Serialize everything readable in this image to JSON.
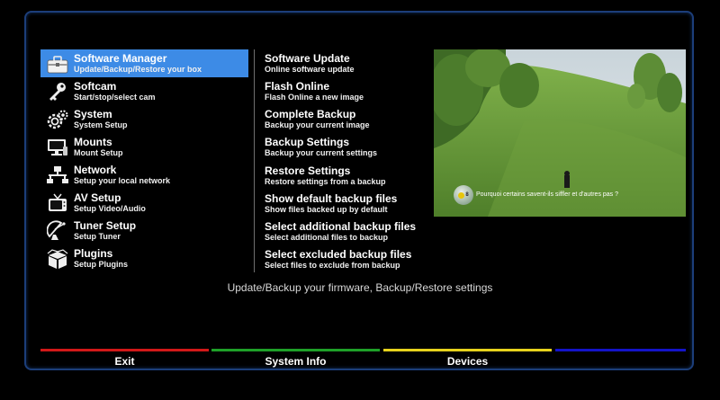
{
  "menu": {
    "items": [
      {
        "title": "Software Manager",
        "sub": "Update/Backup/Restore your box",
        "icon": "toolbox-icon"
      },
      {
        "title": "Softcam",
        "sub": "Start/stop/select cam",
        "icon": "key-icon"
      },
      {
        "title": "System",
        "sub": "System Setup",
        "icon": "gears-icon"
      },
      {
        "title": "Mounts",
        "sub": "Mount Setup",
        "icon": "monitor-icon"
      },
      {
        "title": "Network",
        "sub": "Setup your local network",
        "icon": "network-icon"
      },
      {
        "title": "AV Setup",
        "sub": "Setup Video/Audio",
        "icon": "tv-icon"
      },
      {
        "title": "Tuner Setup",
        "sub": "Setup Tuner",
        "icon": "satellite-dish-icon"
      },
      {
        "title": "Plugins",
        "sub": "Setup Plugins",
        "icon": "puzzle-box-icon"
      }
    ],
    "selected_index": 0
  },
  "sublist": {
    "items": [
      {
        "title": "Software Update",
        "sub": "Online software update"
      },
      {
        "title": "Flash Online",
        "sub": "Flash Online a new image"
      },
      {
        "title": "Complete Backup",
        "sub": "Backup your current image"
      },
      {
        "title": "Backup Settings",
        "sub": "Backup your current settings"
      },
      {
        "title": "Restore Settings",
        "sub": "Restore settings from a backup"
      },
      {
        "title": "Show default backup files",
        "sub": "Show files backed up by default"
      },
      {
        "title": "Select additional backup files",
        "sub": "Select additional files to backup"
      },
      {
        "title": "Select excluded backup files",
        "sub": "Select files to exclude from backup"
      }
    ]
  },
  "preview": {
    "subtitle": "Pourquoi certains savent-ils siffler et d'autres pas ?",
    "channel_badge": "8"
  },
  "description": "Update/Backup your firmware, Backup/Restore settings",
  "buttons": [
    {
      "label": "Exit",
      "color": "#d11818"
    },
    {
      "label": "System Info",
      "color": "#1ea028"
    },
    {
      "label": "Devices",
      "color": "#e6d21c"
    },
    {
      "label": "",
      "color": "#1414c8"
    }
  ],
  "colors": {
    "selection": "#3d8be6",
    "frame": "#1c3e7a"
  }
}
